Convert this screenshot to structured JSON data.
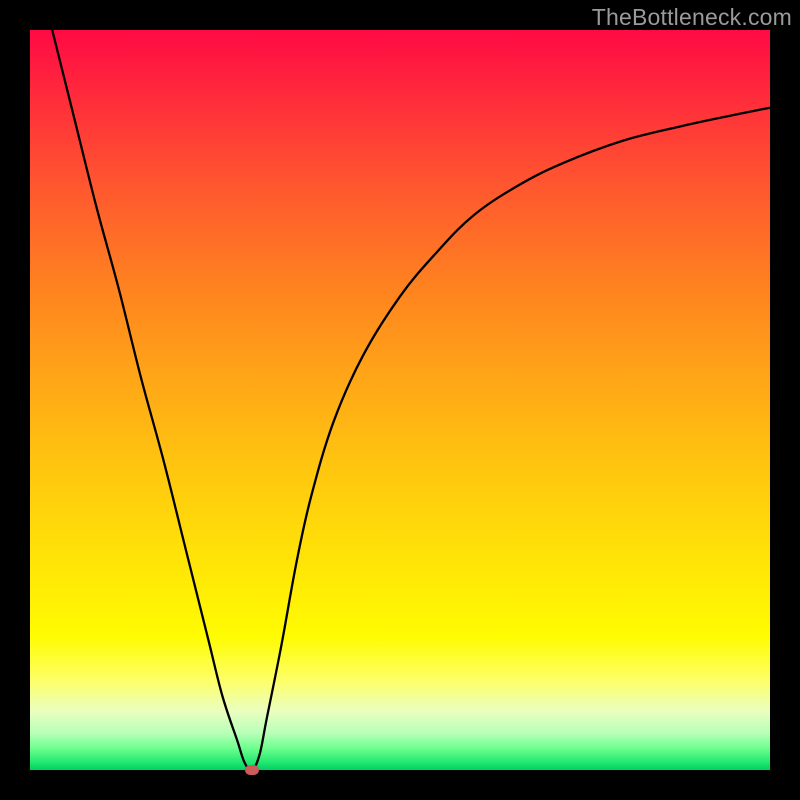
{
  "watermark": "TheBottleneck.com",
  "chart_data": {
    "type": "line",
    "title": "",
    "xlabel": "",
    "ylabel": "",
    "xlim": [
      0,
      100
    ],
    "ylim": [
      0,
      100
    ],
    "x": [
      3,
      6,
      9,
      12,
      15,
      18,
      21,
      24,
      26,
      28,
      29,
      30,
      31,
      32,
      34,
      36,
      38,
      41,
      45,
      50,
      55,
      60,
      66,
      72,
      80,
      88,
      95,
      100
    ],
    "values": [
      100,
      88,
      76,
      65,
      53,
      42,
      30,
      18,
      10,
      4,
      1,
      0,
      2,
      7,
      17,
      28,
      37,
      47,
      56,
      64,
      70,
      75,
      79,
      82,
      85,
      87,
      88.5,
      89.5
    ],
    "marker": {
      "x": 30,
      "y": 0,
      "color": "#cc5c5c"
    },
    "gradient_stops": [
      {
        "pos": 0,
        "color": "#ff0a44"
      },
      {
        "pos": 10,
        "color": "#ff2f3a"
      },
      {
        "pos": 22,
        "color": "#ff5a2e"
      },
      {
        "pos": 34,
        "color": "#ff8020"
      },
      {
        "pos": 46,
        "color": "#ffa318"
      },
      {
        "pos": 58,
        "color": "#ffc310"
      },
      {
        "pos": 70,
        "color": "#ffe008"
      },
      {
        "pos": 82,
        "color": "#fffc02"
      },
      {
        "pos": 88,
        "color": "#fdff6a"
      },
      {
        "pos": 92,
        "color": "#eaffc0"
      },
      {
        "pos": 95,
        "color": "#b8ffb8"
      },
      {
        "pos": 97,
        "color": "#70ff90"
      },
      {
        "pos": 99,
        "color": "#20e870"
      },
      {
        "pos": 100,
        "color": "#00d060"
      }
    ]
  }
}
